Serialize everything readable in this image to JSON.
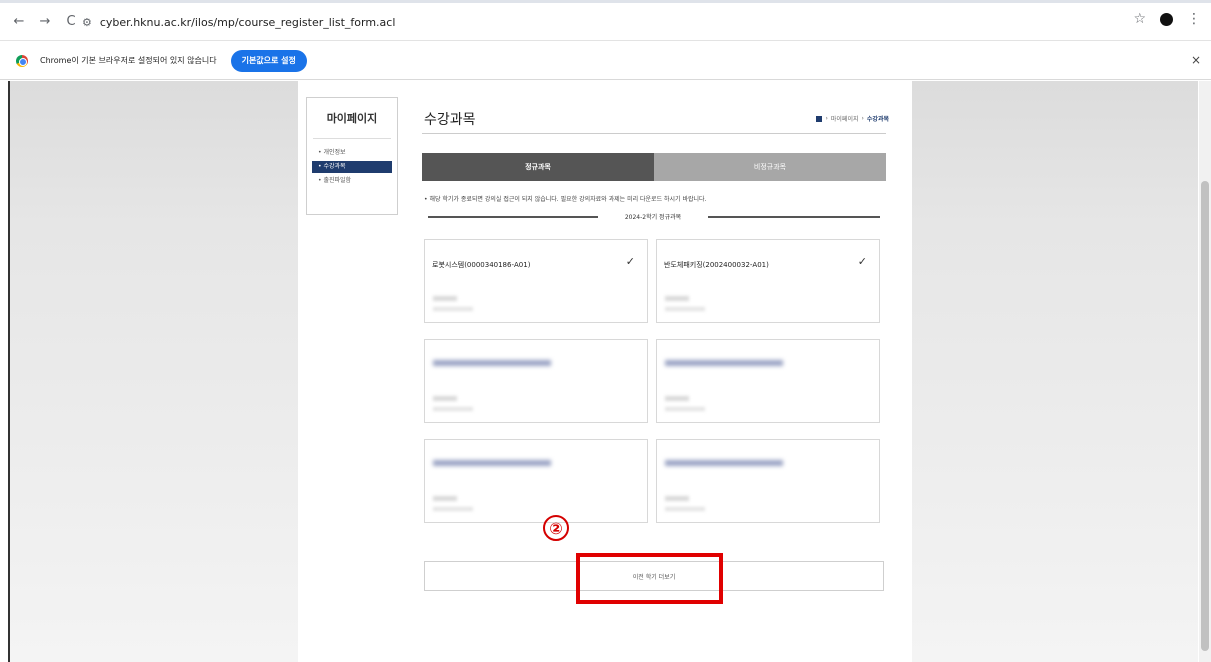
{
  "browser": {
    "url": "cyber.hknu.ac.kr/ilos/mp/course_register_list_form.acl",
    "nav_back": "←",
    "nav_forward": "→",
    "nav_reload": "C",
    "site_info": "⚙",
    "bookmark_star": "☆",
    "menu_kebab": "⋮"
  },
  "infobar": {
    "message": "Chrome이 기본 브라우저로 설정되어 있지 않습니다",
    "button_label": "기본값으로 설정",
    "close": "×"
  },
  "sidebar": {
    "title": "마이페이지",
    "items": [
      {
        "label": "• 개인정보",
        "active": false
      },
      {
        "label": "• 수강과목",
        "active": true
      },
      {
        "label": "• 출진파일함",
        "active": false
      }
    ]
  },
  "main": {
    "title": "수강과목",
    "breadcrumb": {
      "home_sep": "›",
      "mypage": "마이페이지",
      "sep": "›",
      "current": "수강과목"
    },
    "tabs": [
      {
        "label": "정규과목",
        "active": true
      },
      {
        "label": "비정규과목",
        "active": false
      }
    ],
    "notice": "• 해당 학기가 종료되면 강의실 접근이 되지 않습니다. 필요한 강의자료와 과제는 미리 다운로드 하시기 바랍니다.",
    "semester_label": "2024-2학기 정규과목",
    "courses": [
      {
        "name": "로봇시스템(0000340186-A01)",
        "check": "✓"
      },
      {
        "name": "반도체패키징(2002400032-A01)",
        "check": "✓"
      }
    ],
    "annotation_number": "②",
    "prev_semester_button": "이전 학기 더보기"
  }
}
